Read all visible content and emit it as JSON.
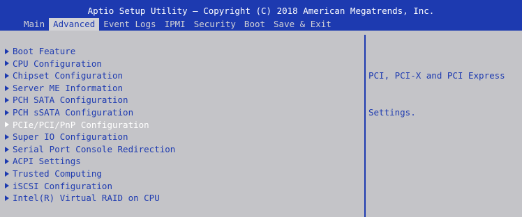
{
  "title": "Aptio Setup Utility – Copyright (C) 2018 American Megatrends, Inc.",
  "menu": {
    "tabs": [
      {
        "label": "Main"
      },
      {
        "label": "Advanced"
      },
      {
        "label": "Event Logs"
      },
      {
        "label": "IPMI"
      },
      {
        "label": "Security"
      },
      {
        "label": "Boot"
      },
      {
        "label": "Save & Exit"
      }
    ],
    "active_tab": "Advanced"
  },
  "items": [
    {
      "label": "Boot Feature"
    },
    {
      "label": "CPU Configuration"
    },
    {
      "label": "Chipset Configuration"
    },
    {
      "label": "Server ME Information"
    },
    {
      "label": "PCH SATA Configuration"
    },
    {
      "label": "PCH sSATA Configuration"
    },
    {
      "label": "PCIe/PCI/PnP Configuration"
    },
    {
      "label": "Super IO Configuration"
    },
    {
      "label": "Serial Port Console Redirection"
    },
    {
      "label": "ACPI Settings"
    },
    {
      "label": "Trusted Computing"
    },
    {
      "label": "iSCSI Configuration"
    },
    {
      "label": "Intel(R) Virtual RAID on CPU"
    }
  ],
  "selected_item": "PCIe/PCI/PnP Configuration",
  "help": {
    "line1": "PCI, PCI-X and PCI Express",
    "line2": "Settings."
  },
  "colors": {
    "header_bg": "#1d3ab0",
    "panel_bg": "#c4c4c8",
    "text": "#1d3ab0",
    "highlight_text": "#ffffff"
  },
  "icons": {
    "submenu": "right-triangle-icon"
  }
}
